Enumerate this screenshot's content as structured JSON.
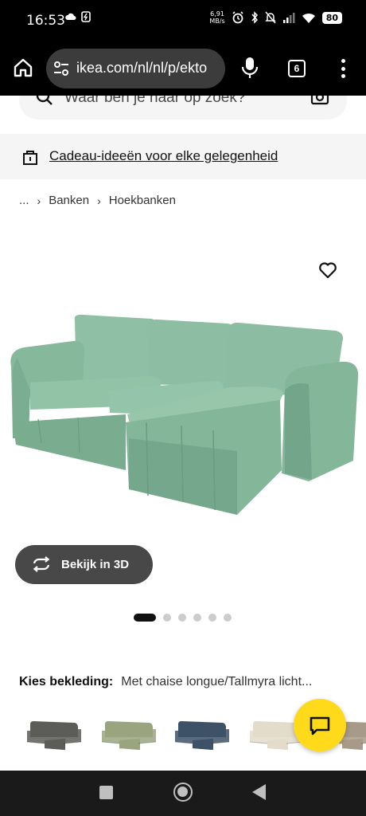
{
  "status_bar": {
    "time": "16:53",
    "net_speed_value": "6,91",
    "net_speed_unit": "MB/s",
    "battery": "80"
  },
  "browser": {
    "url": "ikea.com/nl/nl/p/ekto",
    "tab_count": "6"
  },
  "search": {
    "placeholder": "Waar ben je naar op zoek?"
  },
  "promo": {
    "text": "Cadeau-ideeën voor elke gelegenheid"
  },
  "breadcrumb": {
    "items": [
      "...",
      "Banken",
      "Hoekbanken"
    ]
  },
  "product": {
    "image_alt": "Groene hoekbank met chaise longue",
    "view_3d_label": "Bekijk in 3D",
    "gallery_count": 6,
    "gallery_active": 0,
    "cover_label": "Kies bekleding:",
    "cover_value": "Met chaise longue/Tallmyra licht..."
  },
  "swatches": [
    {
      "name": "dark-grey",
      "color": "#5c5c58"
    },
    {
      "name": "sage-green",
      "color": "#9aa57f"
    },
    {
      "name": "dark-blue",
      "color": "#3d5266"
    },
    {
      "name": "cream",
      "color": "#e3dccb"
    },
    {
      "name": "striped-beige",
      "color": "#a89a88"
    }
  ],
  "colors": {
    "sofa": "#8fbfa4",
    "chat_button": "#ffda1a"
  }
}
